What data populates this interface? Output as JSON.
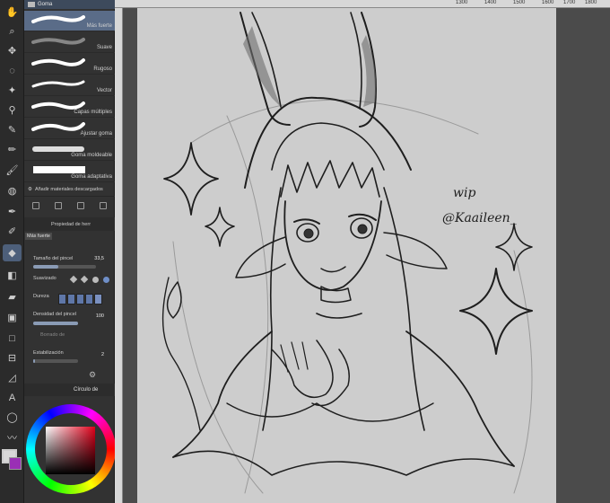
{
  "brushes": {
    "header": "Goma",
    "items": [
      {
        "name": "Más fuerte",
        "selected": true
      },
      {
        "name": "Suave"
      },
      {
        "name": "Rugoso"
      },
      {
        "name": "Vector"
      },
      {
        "name": "Capas múltiples"
      },
      {
        "name": "Ajustar goma"
      },
      {
        "name": "Goma moldeable"
      },
      {
        "name": "Goma adaptativa"
      }
    ],
    "add_label": "Añadir materiales descargados"
  },
  "properties": {
    "header": "Propiedad de herr",
    "preset": "Más fuerte",
    "size_label": "Tamaño del pincel",
    "size_value": "33,5",
    "smoothing_label": "Suavizado",
    "hardness_label": "Dureza",
    "density_label": "Densidad del pincel",
    "density_value": "100",
    "erase_label": "Borrado de",
    "stabilization_label": "Estabilización",
    "stabilization_value": "2"
  },
  "color": {
    "header": "Círculo de",
    "foreground": "#d8d8d8",
    "background": "#9a2fb5"
  },
  "ruler": {
    "labels": [
      "1300",
      "1400",
      "1500",
      "1600",
      "1700",
      "1800"
    ]
  },
  "artwork": {
    "caption_line1": "wip",
    "caption_line2": "@Kaaileen_"
  }
}
